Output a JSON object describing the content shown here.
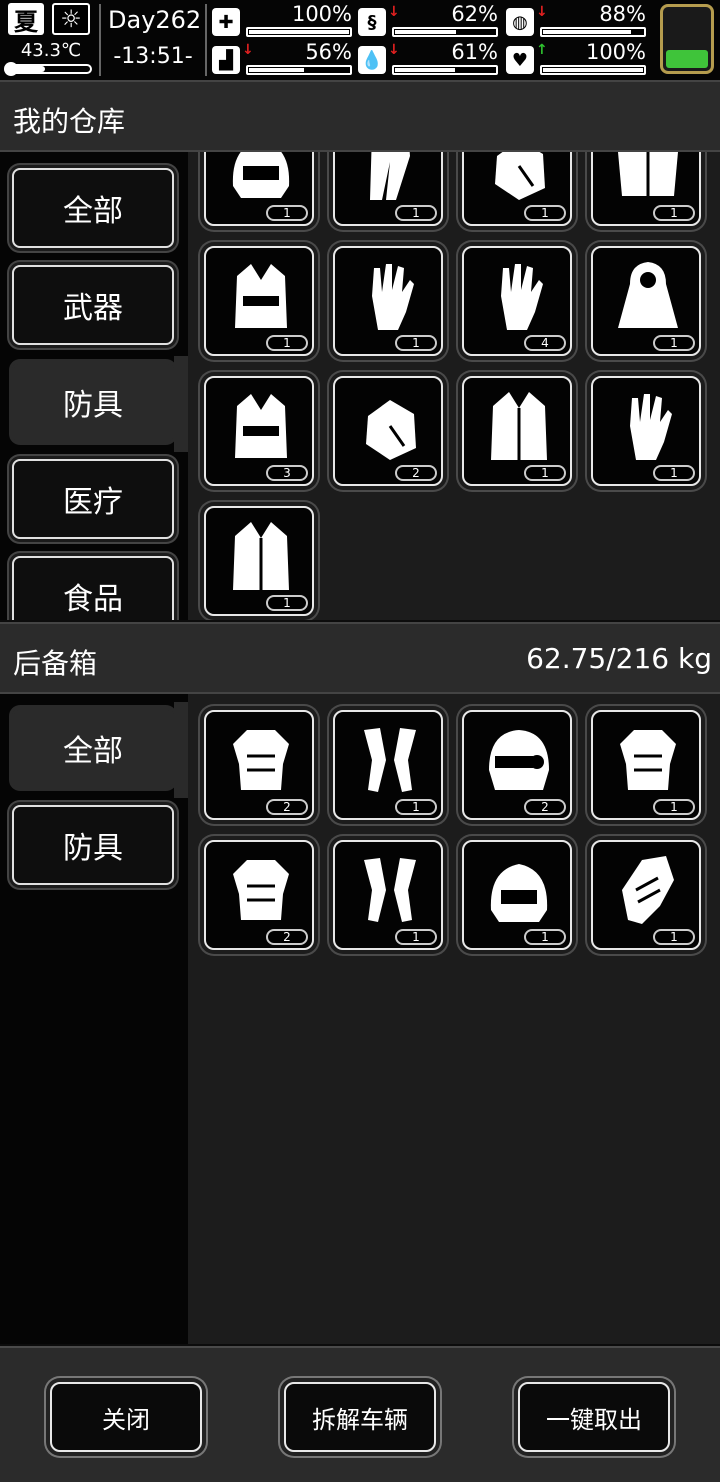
{
  "status": {
    "season": "夏",
    "weather_icon": "sun-icon",
    "temperature": "43.3℃",
    "thermometer_level": 0.45,
    "day": "Day262",
    "time": "-13:51-",
    "stats": [
      {
        "name": "health",
        "icon": "medkit-icon",
        "glyph": "✚",
        "arrow": "",
        "value": "100%",
        "level": 1.0
      },
      {
        "name": "hunger",
        "icon": "stomach-icon",
        "glyph": "§",
        "arrow": "↓",
        "arrow_color": "#e02020",
        "value": "62%",
        "level": 0.62
      },
      {
        "name": "energy",
        "icon": "pill-icon",
        "glyph": "◍",
        "arrow": "↓",
        "arrow_color": "#e02020",
        "value": "88%",
        "level": 0.88
      },
      {
        "name": "stamina",
        "icon": "boot-icon",
        "glyph": "▟",
        "arrow": "↓",
        "arrow_color": "#e02020",
        "value": "56%",
        "level": 0.56
      },
      {
        "name": "thirst",
        "icon": "water-drop-icon",
        "glyph": "💧",
        "arrow": "↓",
        "arrow_color": "#e02020",
        "value": "61%",
        "level": 0.61
      },
      {
        "name": "mood",
        "icon": "heart-icon",
        "glyph": "♥",
        "arrow": "↑",
        "arrow_color": "#2ec02e",
        "value": "100%",
        "level": 1.0
      }
    ],
    "battery_icon": "battery-icon",
    "battery_color": "#3fc43a"
  },
  "warehouse": {
    "title": "我的仓库",
    "categories": [
      {
        "label": "全部",
        "active": false
      },
      {
        "label": "武器",
        "active": false
      },
      {
        "label": "防具",
        "active": true
      },
      {
        "label": "医疗",
        "active": false
      },
      {
        "label": "食品",
        "active": false
      }
    ],
    "items": [
      {
        "icon": "helmet-icon",
        "count": "1"
      },
      {
        "icon": "pants-icon",
        "count": "1"
      },
      {
        "icon": "gloves-icon",
        "count": "1"
      },
      {
        "icon": "jacket-icon",
        "count": "1"
      },
      {
        "icon": "fur-vest-icon",
        "count": "1"
      },
      {
        "icon": "fingerless-gloves-icon",
        "count": "1"
      },
      {
        "icon": "riveted-gloves-icon",
        "count": "4"
      },
      {
        "icon": "hooded-cloak-icon",
        "count": "1"
      },
      {
        "icon": "tactical-vest-icon",
        "count": "3"
      },
      {
        "icon": "tactical-gloves-icon",
        "count": "2"
      },
      {
        "icon": "fur-coat-icon",
        "count": "1"
      },
      {
        "icon": "padded-gloves-icon",
        "count": "1"
      },
      {
        "icon": "fur-robe-icon",
        "count": "1"
      }
    ]
  },
  "trunk": {
    "title": "后备箱",
    "weight": "62.75/216 kg",
    "categories": [
      {
        "label": "全部",
        "active": true
      },
      {
        "label": "防具",
        "active": false
      }
    ],
    "items": [
      {
        "icon": "body-armor-icon",
        "count": "2"
      },
      {
        "icon": "leg-guards-icon",
        "count": "1"
      },
      {
        "icon": "visor-helmet-icon",
        "count": "2"
      },
      {
        "icon": "plate-carrier-icon",
        "count": "1"
      },
      {
        "icon": "harness-armor-icon",
        "count": "2"
      },
      {
        "icon": "arm-guards-icon",
        "count": "1"
      },
      {
        "icon": "combat-helmet-icon",
        "count": "1"
      },
      {
        "icon": "gauntlet-icon",
        "count": "1"
      }
    ]
  },
  "buttons": {
    "close": "关闭",
    "dismantle": "拆解车辆",
    "take_all": "一键取出"
  }
}
